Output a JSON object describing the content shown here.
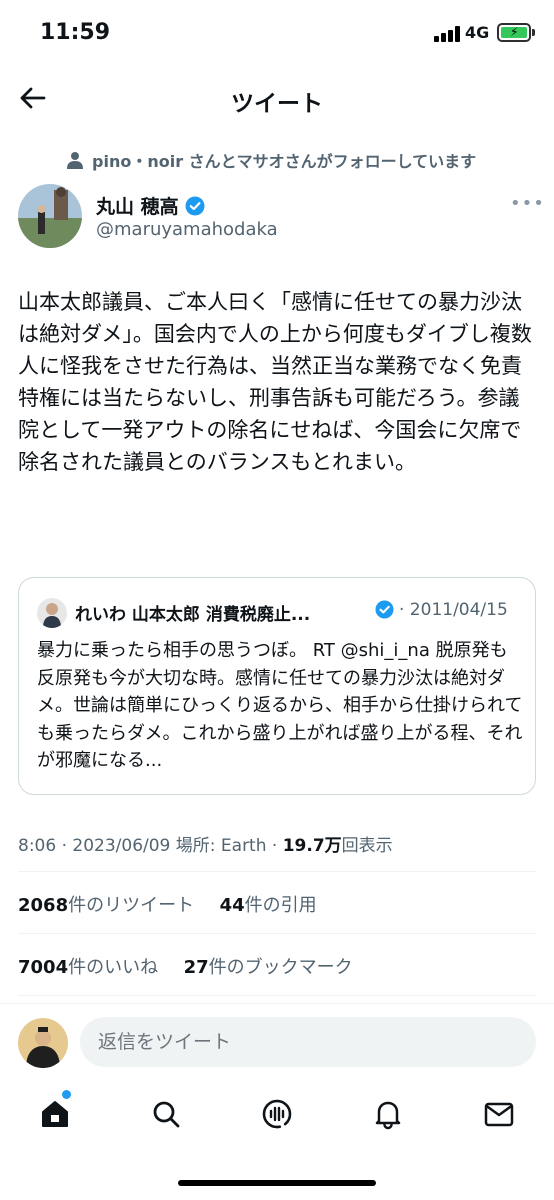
{
  "status_bar": {
    "time": "11:59",
    "network": "4G"
  },
  "header": {
    "title": "ツイート"
  },
  "social_context": "pino・noir さんとマサオさんがフォローしています",
  "author": {
    "name": "丸山 穂高",
    "handle": "@maruyamahodaka"
  },
  "tweet": {
    "text": "山本太郎議員、ご本人曰く「感情に任せての暴力沙汰は絶対ダメ」。国会内で人の上から何度もダイブし複数人に怪我をさせた行為は、当然正当な業務でなく免責特権には当たらないし、刑事告訴も可能だろう。参議院として一発アウトの除名にせねば、今国会に欠席で除名された議員とのバランスもとれまい。"
  },
  "quote": {
    "name": "れいわ 山本太郎 消費税廃止...",
    "date": "· 2011/04/15",
    "text": "暴力に乗ったら相手の思うつぼ。 RT @shi_i_na 脱原発も反原発も今が大切な時。感情に任せての暴力沙汰は絶対ダメ。世論は簡単にひっくり返るから、相手から仕掛けられても乗ったらダメ。これから盛り上がれば盛り上がる程、それが邪魔になる..."
  },
  "meta": {
    "time_date": "8:06 · 2023/06/09",
    "location": "場所: Earth ·",
    "views_count": "19.7万",
    "views_label": "回表示"
  },
  "stats": {
    "retweets_count": "2068",
    "retweets_label": "件のリツイート",
    "quotes_count": "44",
    "quotes_label": "件の引用",
    "likes_count": "7004",
    "likes_label": "件のいいね",
    "bookmarks_count": "27",
    "bookmarks_label": "件のブックマーク"
  },
  "reply": {
    "placeholder": "返信をツイート"
  },
  "colors": {
    "verified": "#1d9bf0",
    "secondary_text": "#536471",
    "divider": "#eff3f4",
    "battery": "#34c759"
  },
  "icons": {
    "back": "arrow-left-icon",
    "home": "home-icon",
    "search": "search-icon",
    "spaces": "spaces-icon",
    "notifications": "bell-icon",
    "messages": "envelope-icon"
  }
}
